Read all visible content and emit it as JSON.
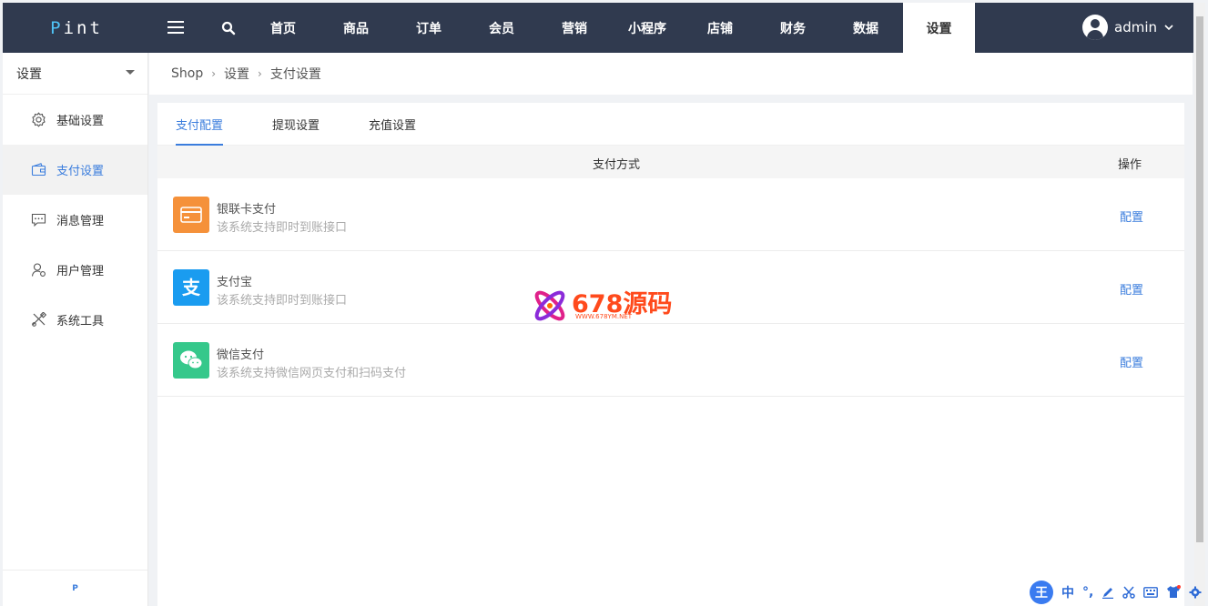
{
  "logo": {
    "prefix": "P",
    "rest": "int"
  },
  "nav": {
    "items": [
      {
        "label": "首页"
      },
      {
        "label": "商品"
      },
      {
        "label": "订单"
      },
      {
        "label": "会员"
      },
      {
        "label": "营销"
      },
      {
        "label": "小程序"
      },
      {
        "label": "店铺"
      },
      {
        "label": "财务"
      },
      {
        "label": "数据"
      },
      {
        "label": "设置"
      }
    ],
    "active": "设置",
    "user": "admin"
  },
  "sidebar": {
    "header": "设置",
    "items": [
      {
        "label": "基础设置",
        "icon": "gear-icon"
      },
      {
        "label": "支付设置",
        "icon": "wallet-icon",
        "active": true
      },
      {
        "label": "消息管理",
        "icon": "message-icon"
      },
      {
        "label": "用户管理",
        "icon": "user-icon"
      },
      {
        "label": "系统工具",
        "icon": "tools-icon"
      }
    ],
    "footer": "P"
  },
  "breadcrumb": {
    "items": [
      "Shop",
      "设置",
      "支付设置"
    ]
  },
  "tabs": [
    "支付配置",
    "提现设置",
    "充值设置"
  ],
  "table": {
    "headers": [
      "支付方式",
      "操作"
    ],
    "rows": [
      {
        "name": "银联卡支付",
        "desc": "该系统支持即时到账接口",
        "action": "配置",
        "icon": "card-icon",
        "color": "#f5913a"
      },
      {
        "name": "支付宝",
        "desc": "该系统支持即时到账接口",
        "action": "配置",
        "icon": "alipay-icon",
        "color": "#1a9cf0"
      },
      {
        "name": "微信支付",
        "desc": "该系统支持微信网页支付和扫码支付",
        "action": "配置",
        "icon": "wechat-icon",
        "color": "#35c88b"
      }
    ]
  },
  "watermark": {
    "title": "678源码",
    "url": "WWW.678YM.NET"
  },
  "ime": {
    "logo": "王",
    "mode": "中"
  },
  "colors": {
    "topbar": "#303a4f",
    "accent": "#3b7ddd",
    "watermark": "#ff4a1c"
  }
}
